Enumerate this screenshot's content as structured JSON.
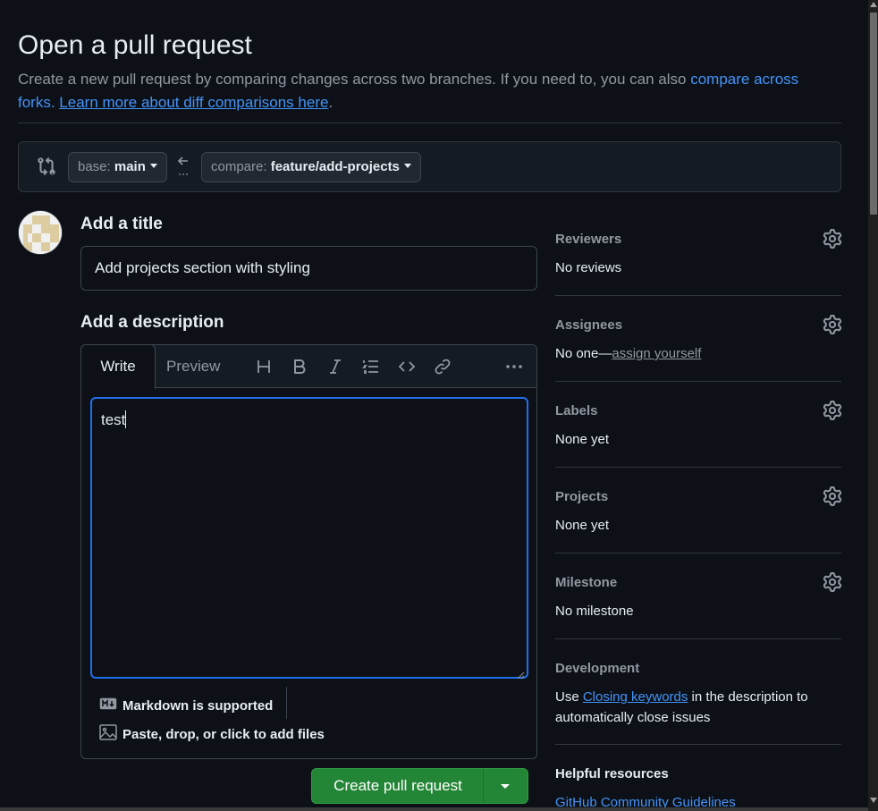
{
  "page": {
    "title": "Open a pull request",
    "subtitle_text": "Create a new pull request by comparing changes across two branches. If you need to, you can also ",
    "subtitle_link1": "compare across forks.",
    "subtitle_link2": "Learn more about diff comparisons here",
    "subtitle_end": "."
  },
  "branches": {
    "base_prefix": "base: ",
    "base_name": "main",
    "compare_prefix": "compare: ",
    "compare_name": "feature/add-projects"
  },
  "form": {
    "title_label": "Add a title",
    "title_value": "Add projects section with styling",
    "description_label": "Add a description",
    "tab_write": "Write",
    "tab_preview": "Preview",
    "body_value": "test",
    "markdown_note": "Markdown is supported",
    "attach_note": "Paste, drop, or click to add files",
    "submit_label": "Create pull request"
  },
  "toolbar": {
    "icons": [
      "heading-icon",
      "bold-icon",
      "italic-icon",
      "list-icon",
      "code-icon",
      "link-icon",
      "more-icon"
    ]
  },
  "sidebar": {
    "reviewers": {
      "label": "Reviewers",
      "value": "No reviews"
    },
    "assignees": {
      "label": "Assignees",
      "value_prefix": "No one—",
      "value_link": "assign yourself"
    },
    "labels": {
      "label": "Labels",
      "value": "None yet"
    },
    "projects": {
      "label": "Projects",
      "value": "None yet"
    },
    "milestone": {
      "label": "Milestone",
      "value": "No milestone"
    },
    "development": {
      "label": "Development",
      "text_before": "Use ",
      "link": "Closing keywords",
      "text_after": " in the description to automatically close issues"
    },
    "helpful": {
      "label": "Helpful resources",
      "link": "GitHub Community Guidelines"
    }
  },
  "colors": {
    "background": "#0d1117",
    "accent_blue": "#4493f8",
    "button_green": "#238636",
    "focus_border": "#1f6feb"
  }
}
